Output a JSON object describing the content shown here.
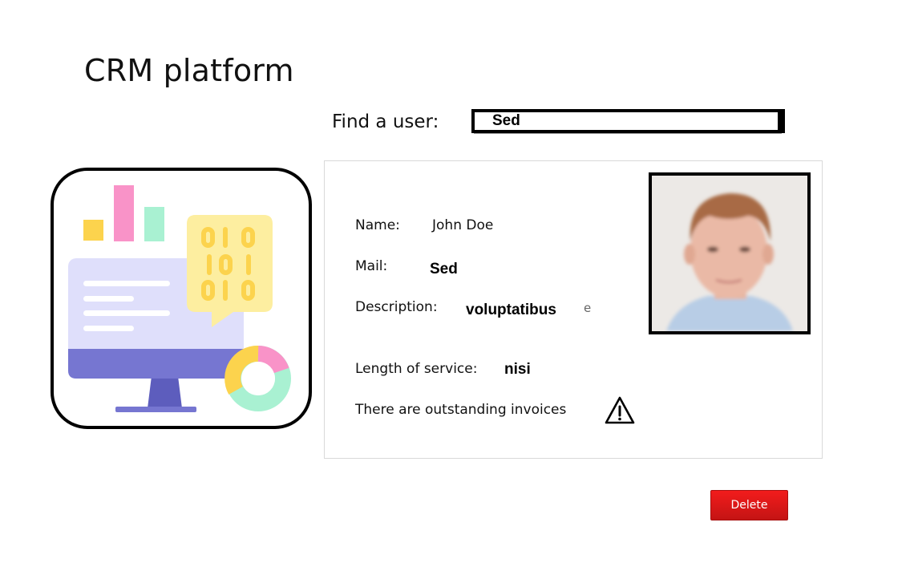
{
  "app": {
    "title": "CRM platform"
  },
  "search": {
    "label": "Find a user:",
    "value": "Sed"
  },
  "user": {
    "name_label": "Name:",
    "name_value": "John Doe",
    "mail_label": "Mail:",
    "mail_value": "Sed",
    "description_label": "Description:",
    "description_value": "voluptatibus",
    "description_trailing": "e",
    "service_label": "Length of service:",
    "service_value": "nisi",
    "invoices_notice": "There are outstanding invoices"
  },
  "icons": {
    "illustration": "crm-dashboard-illustration",
    "warning": "warning-icon",
    "photo": "user-photo"
  },
  "actions": {
    "delete_label": "Delete"
  },
  "colors": {
    "delete": "#e31a1a",
    "monitor_base": "#7676d1",
    "screen": "#dfdffb",
    "bubble": "#fdeea0",
    "binary": "#fcd34d",
    "bar_yellow": "#fcd34d",
    "bar_pink": "#f993c8",
    "bar_mint": "#a9f1d2"
  }
}
